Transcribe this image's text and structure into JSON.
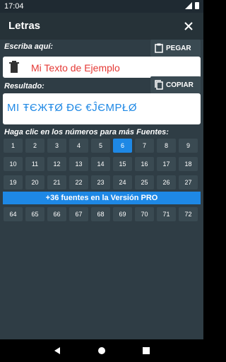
{
  "status": {
    "time": "17:04"
  },
  "appbar": {
    "title": "Letras",
    "close_icon": "close-icon"
  },
  "input": {
    "label": "Escriba aquí:",
    "paste_button": "PEGAR",
    "value": "Mi Texto de Ejemplo"
  },
  "result": {
    "label": "Resultado:",
    "copy_button": "COPIAR",
    "value": "MI ŦЄЖŦØ ÐЄ €ĴЄMPŁØ"
  },
  "fonts": {
    "label": "Haga clic en los números para más Fuentes:",
    "numbers_top": [
      "1",
      "2",
      "3",
      "4",
      "5",
      "6",
      "7",
      "8",
      "9",
      "10",
      "11",
      "12",
      "13",
      "14",
      "15",
      "16",
      "17",
      "18",
      "19",
      "20",
      "21",
      "22",
      "23",
      "24",
      "25",
      "26",
      "27"
    ],
    "selected": "6",
    "pro_label": "+36 fuentes en la Versión PRO",
    "numbers_bottom": [
      "64",
      "65",
      "66",
      "67",
      "68",
      "69",
      "70",
      "71",
      "72"
    ]
  },
  "colors": {
    "accent": "#1e88e5",
    "error_text": "#e53935",
    "bg": "#2f3d45",
    "appbar": "#263238"
  }
}
